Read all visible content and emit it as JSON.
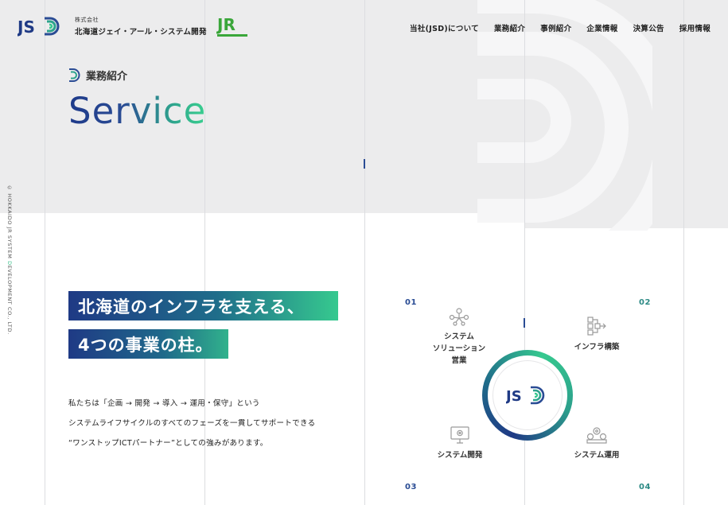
{
  "header": {
    "company_small": "株式会社",
    "company_name": "北海道ジェイ・アール・システム開発",
    "nav": [
      "当社(JSD)について",
      "業務紹介",
      "事例紹介",
      "企業情報",
      "決算公告",
      "採用情報"
    ]
  },
  "section": {
    "label": "業務紹介",
    "title": "Service"
  },
  "copyright": {
    "prefix": "© HOKKAIDO JR SYSTEM ",
    "accent": "D",
    "suffix": "EVELOPMENT CO., LTD."
  },
  "headline": {
    "line1": "北海道のインフラを支える、",
    "line2": "4つの事業の柱。"
  },
  "body": {
    "line1": "私たちは「企画 → 開発 → 導入 → 運用・保守」という",
    "line2": "システムライフサイクルのすべてのフェーズを一貫してサポートできる",
    "line3": "“ワンストップICTパートナー”としての強みがあります。"
  },
  "pillars": [
    {
      "num": "01",
      "label": "システム\nソリューション\n営業",
      "icon": "people-network-icon"
    },
    {
      "num": "02",
      "label": "インフラ構築",
      "icon": "infrastructure-icon"
    },
    {
      "num": "03",
      "label": "システム開発",
      "icon": "monitor-gear-icon"
    },
    {
      "num": "04",
      "label": "システム運用",
      "icon": "gears-icon"
    }
  ],
  "colors": {
    "navy": "#1f3a85",
    "teal": "#2d8a85",
    "green": "#36c98f",
    "bg_gray": "#ececed"
  }
}
